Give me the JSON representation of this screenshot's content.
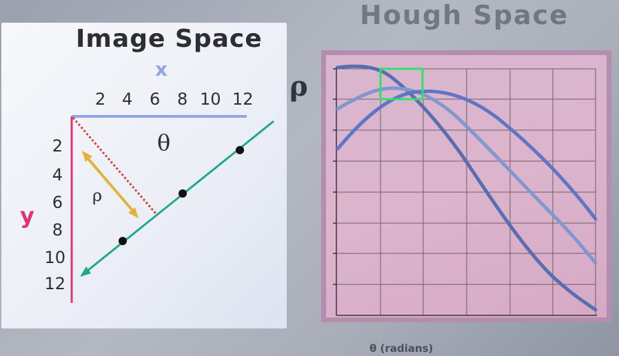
{
  "image_space": {
    "title": "Image Space",
    "x_axis_label": "x",
    "y_axis_label": "y",
    "theta_label": "θ",
    "rho_label": "ρ",
    "x_ticks": [
      "2",
      "4",
      "6",
      "8",
      "10",
      "12"
    ],
    "y_ticks": [
      "2",
      "4",
      "6",
      "8",
      "10",
      "12"
    ]
  },
  "hough_space": {
    "title": "Hough Space",
    "rho_label": "ρ",
    "theta_label": "θ (radians)"
  },
  "colors": {
    "axis_x": "#8fa6e6",
    "axis_y": "#e0327a",
    "line": "#1fa88a",
    "perpendicular": "#d0453a",
    "rho_arrow": "#e0b43a",
    "curve_dark": "#5a6db0",
    "curve_mid": "#6076c2",
    "curve_light": "#8097cf",
    "highlight": "#2fe06a"
  }
}
